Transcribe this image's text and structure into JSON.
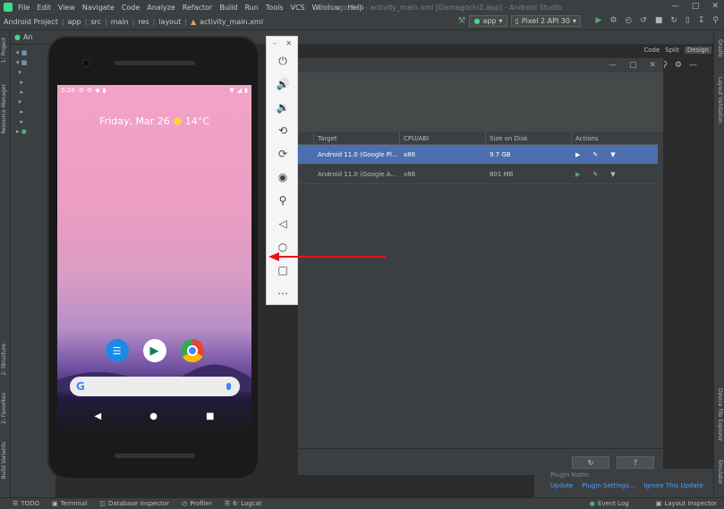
{
  "menubar": {
    "items": [
      "File",
      "Edit",
      "View",
      "Navigate",
      "Code",
      "Analyze",
      "Refactor",
      "Build",
      "Run",
      "Tools",
      "VCS",
      "Window",
      "Help"
    ],
    "window_title": "Damagochi1 - activity_main.xml [Damagochi1.app] - Android Studio"
  },
  "navbar": {
    "crumbs": [
      "Android Project",
      "app",
      "src",
      "main",
      "res",
      "layout",
      "activity_main.xml"
    ],
    "run_config": "app",
    "device": "Pixel 2 API 30"
  },
  "project_panel": {
    "label": "An"
  },
  "left_tabs": {
    "project": "1: Project",
    "resource_manager": "Resource Manager",
    "structure": "2: Structure",
    "favorites": "2: Favorites",
    "build_variants": "Build Variants"
  },
  "right_tabs": {
    "gradle": "Gradle",
    "layout_validation": "Layout Validation",
    "device_file_explorer": "Device File Explorer",
    "emulator": "Emulator"
  },
  "view_modes": {
    "code": "Code",
    "split": "Split",
    "design": "Design"
  },
  "device_manager": {
    "columns": [
      "Target",
      "CPU/ABI",
      "Size on Disk",
      "Actions"
    ],
    "rows": [
      {
        "target": "Android 11.0 (Google Pl...",
        "cpu": "x86",
        "size": "9.7 GB"
      },
      {
        "target": "Android 11.0 (Google A...",
        "cpu": "x86",
        "size": "801 MB"
      }
    ]
  },
  "notification": {
    "title": "Plugin Kotlin",
    "links": [
      "Update",
      "Plugin Settings...",
      "Ignore This Update"
    ]
  },
  "statusbar": {
    "left": [
      "TODO",
      "Terminal",
      "Database Inspector",
      "Profiler",
      "6: Logcat"
    ],
    "right": [
      "Event Log",
      "Layout Inspector"
    ]
  },
  "phone": {
    "time": "5:26",
    "glance_text": "Friday, Mar 26",
    "temperature": "14°C",
    "search_logo": "G"
  },
  "emulator_toolbar": {
    "icons": [
      "power-icon",
      "volume-up-icon",
      "volume-down-icon",
      "rotate-left-icon",
      "rotate-right-icon",
      "camera-icon",
      "zoom-icon",
      "back-icon",
      "home-icon",
      "overview-icon",
      "more-icon"
    ]
  },
  "colors": {
    "ide_bg": "#3c3f41",
    "editor_bg": "#2b2b2b",
    "selection": "#4b6eaf",
    "annotation_arrow": "#e8141b"
  }
}
